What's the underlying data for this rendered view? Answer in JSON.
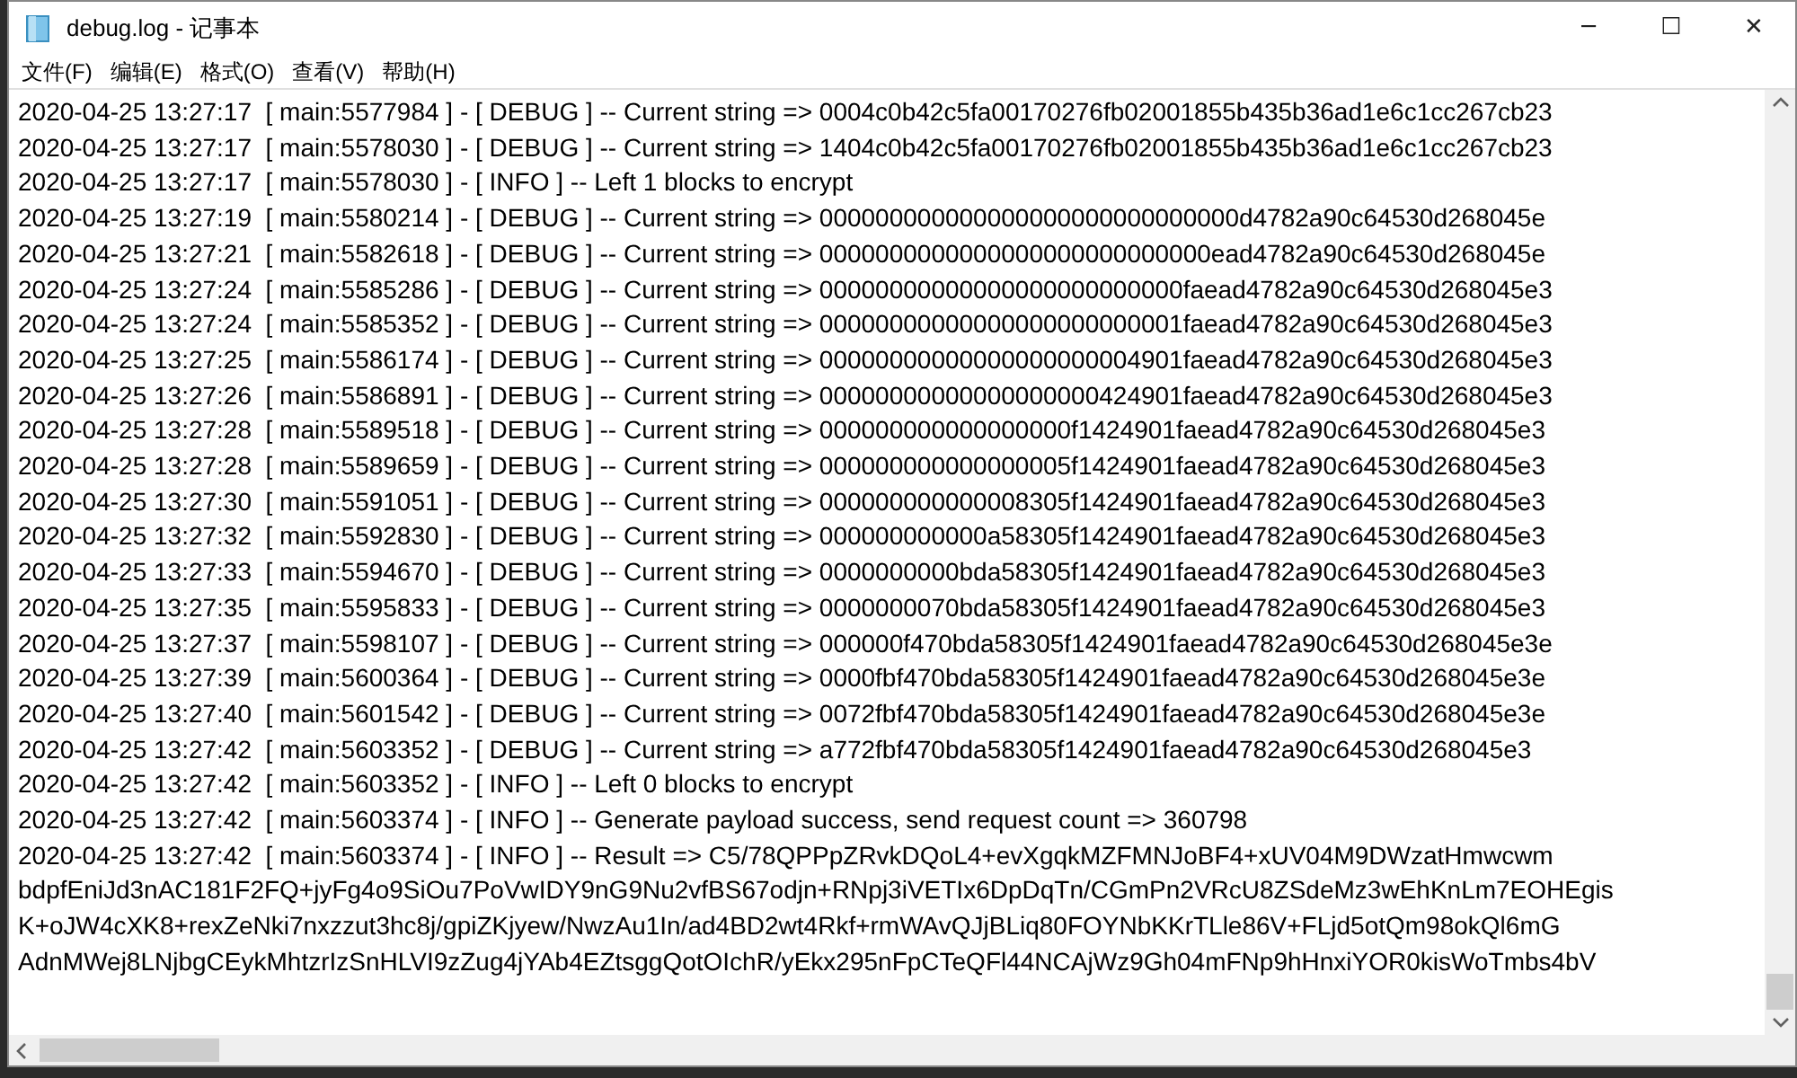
{
  "window": {
    "title": "debug.log - 记事本",
    "controls": [
      "─",
      "☐",
      "✕"
    ]
  },
  "menu": [
    "文件(F)",
    "编辑(E)",
    "格式(O)",
    "查看(V)",
    "帮助(H)"
  ],
  "lines": [
    "2020-04-25 13:27:17  [ main:5577984 ] - [ DEBUG ] -- Current string => 0004c0b42c5fa00170276fb02001855b435b36ad1e6c1cc267cb23",
    "2020-04-25 13:27:17  [ main:5578030 ] - [ DEBUG ] -- Current string => 1404c0b42c5fa00170276fb02001855b435b36ad1e6c1cc267cb23",
    "2020-04-25 13:27:17  [ main:5578030 ] - [ INFO ] -- Left 1 blocks to encrypt",
    "2020-04-25 13:27:19  [ main:5580214 ] - [ DEBUG ] -- Current string => 000000000000000000000000000000d4782a90c64530d268045e",
    "2020-04-25 13:27:21  [ main:5582618 ] - [ DEBUG ] -- Current string => 0000000000000000000000000000ead4782a90c64530d268045e",
    "2020-04-25 13:27:24  [ main:5585286 ] - [ DEBUG ] -- Current string => 00000000000000000000000000faead4782a90c64530d268045e3",
    "2020-04-25 13:27:24  [ main:5585352 ] - [ DEBUG ] -- Current string => 00000000000000000000000001faead4782a90c64530d268045e3",
    "2020-04-25 13:27:25  [ main:5586174 ] - [ DEBUG ] -- Current string => 00000000000000000000004901faead4782a90c64530d268045e3",
    "2020-04-25 13:27:26  [ main:5586891 ] - [ DEBUG ] -- Current string => 00000000000000000000424901faead4782a90c64530d268045e3",
    "2020-04-25 13:27:28  [ main:5589518 ] - [ DEBUG ] -- Current string => 000000000000000000f1424901faead4782a90c64530d268045e3",
    "2020-04-25 13:27:28  [ main:5589659 ] - [ DEBUG ] -- Current string => 000000000000000005f1424901faead4782a90c64530d268045e3",
    "2020-04-25 13:27:30  [ main:5591051 ] - [ DEBUG ] -- Current string => 000000000000008305f1424901faead4782a90c64530d268045e3",
    "2020-04-25 13:27:32  [ main:5592830 ] - [ DEBUG ] -- Current string => 000000000000a58305f1424901faead4782a90c64530d268045e3",
    "2020-04-25 13:27:33  [ main:5594670 ] - [ DEBUG ] -- Current string => 0000000000bda58305f1424901faead4782a90c64530d268045e3",
    "2020-04-25 13:27:35  [ main:5595833 ] - [ DEBUG ] -- Current string => 0000000070bda58305f1424901faead4782a90c64530d268045e3",
    "2020-04-25 13:27:37  [ main:5598107 ] - [ DEBUG ] -- Current string => 000000f470bda58305f1424901faead4782a90c64530d268045e3e",
    "2020-04-25 13:27:39  [ main:5600364 ] - [ DEBUG ] -- Current string => 0000fbf470bda58305f1424901faead4782a90c64530d268045e3e",
    "2020-04-25 13:27:40  [ main:5601542 ] - [ DEBUG ] -- Current string => 0072fbf470bda58305f1424901faead4782a90c64530d268045e3e",
    "2020-04-25 13:27:42  [ main:5603352 ] - [ DEBUG ] -- Current string => a772fbf470bda58305f1424901faead4782a90c64530d268045e3",
    "2020-04-25 13:27:42  [ main:5603352 ] - [ INFO ] -- Left 0 blocks to encrypt",
    "2020-04-25 13:27:42  [ main:5603374 ] - [ INFO ] -- Generate payload success, send request count => 360798",
    "2020-04-25 13:27:42  [ main:5603374 ] - [ INFO ] -- Result => C5/78QPPpZRvkDQoL4+evXgqkMZFMNJoBF4+xUV04M9DWzatHmwcwm",
    "bdpfEniJd3nAC181F2FQ+jyFg4o9SiOu7PoVwIDY9nG9Nu2vfBS67odjn+RNpj3iVETIx6DpDqTn/CGmPn2VRcU8ZSdeMz3wEhKnLm7EOHEgis",
    "K+oJW4cXK8+rexZeNki7nxzzut3hc8j/gpiZKjyew/NwzAu1In/ad4BD2wt4Rkf+rmWAvQJjBLiq80FOYNbKKrTLle86V+FLjd5otQm98okQl6mG",
    "AdnMWej8LNjbgCEykMhtzrIzSnHLVI9zZug4jYAb4EZtsggQotOIchR/yEkx295nFpCTeQFl44NCAjWz9Gh04mFNp9hHnxiYOR0kisWoTmbs4bV"
  ]
}
